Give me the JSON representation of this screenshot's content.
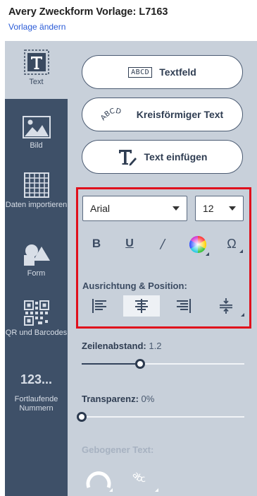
{
  "header": {
    "title": "Avery Zweckform Vorlage: L7163",
    "change_link": "Vorlage ändern"
  },
  "sidebar": {
    "items": [
      {
        "label": "Text",
        "icon": "text-icon",
        "active": true
      },
      {
        "label": "Bild",
        "icon": "image-icon",
        "active": false
      },
      {
        "label": "Daten importieren",
        "icon": "grid-icon",
        "active": false
      },
      {
        "label": "Form",
        "icon": "shapes-icon",
        "active": false
      },
      {
        "label": "QR und Barcodes",
        "icon": "qr-code-icon",
        "active": false
      },
      {
        "label": "Fortlaufende Nummern",
        "icon": "numbering-icon",
        "active": false
      }
    ],
    "numbering_glyph": "123..."
  },
  "panel": {
    "textfield_label": "Textfeld",
    "textfield_icon_text": "ABCD",
    "circular_label": "Kreisförmiger Text",
    "circular_icon_text": "ABCD",
    "insert_label": "Text einfügen",
    "font": {
      "selected": "Arial"
    },
    "size": {
      "selected": "12"
    },
    "format": {
      "bold": "B",
      "underline": "U",
      "italic": "/",
      "special": "Ω"
    },
    "alignment_title": "Ausrichtung & Position:",
    "alignment_active": "center",
    "line_spacing": {
      "label": "Zeilenabstand:",
      "value": "1.2",
      "fraction": 0.36
    },
    "transparency": {
      "label": "Transparenz:",
      "value": "0%",
      "fraction": 0.0
    },
    "curved_text_label": "Gebogener Text:",
    "curved_icon_text": "abc"
  },
  "colors": {
    "sidebar_bg": "#3e5068",
    "panel_bg": "#c8d0da",
    "highlight_box": "#e0101c",
    "link": "#2a5bd7"
  }
}
